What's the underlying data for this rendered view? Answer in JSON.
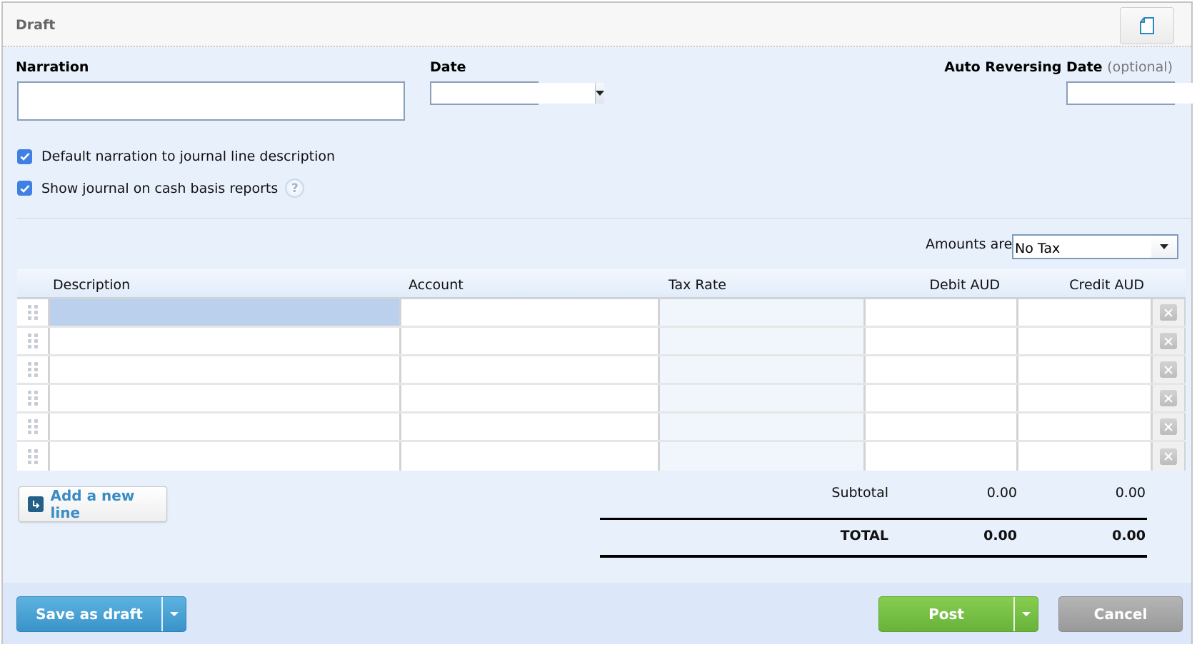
{
  "header": {
    "title": "Draft",
    "doc_button_icon": "document-icon"
  },
  "form": {
    "narration_label": "Narration",
    "narration_value": "",
    "date_label": "Date",
    "date_value": "",
    "auto_reversing_label": "Auto Reversing Date",
    "auto_reversing_optional": "(optional)",
    "auto_reversing_value": "",
    "checkboxes": [
      {
        "label": "Default narration to journal line description",
        "checked": true
      },
      {
        "label": "Show journal on cash basis reports",
        "checked": true,
        "help_icon": "question-mark"
      }
    ],
    "help_glyph": "?",
    "amounts_are_label": "Amounts are",
    "amounts_are_value": "No Tax"
  },
  "grid": {
    "columns": [
      "Description",
      "Account",
      "Tax Rate",
      "Debit AUD",
      "Credit AUD"
    ],
    "rows": [
      {
        "description": "",
        "account": "",
        "tax_rate": "",
        "debit": "",
        "credit": "",
        "active": true
      },
      {
        "description": "",
        "account": "",
        "tax_rate": "",
        "debit": "",
        "credit": ""
      },
      {
        "description": "",
        "account": "",
        "tax_rate": "",
        "debit": "",
        "credit": ""
      },
      {
        "description": "",
        "account": "",
        "tax_rate": "",
        "debit": "",
        "credit": ""
      },
      {
        "description": "",
        "account": "",
        "tax_rate": "",
        "debit": "",
        "credit": ""
      },
      {
        "description": "",
        "account": "",
        "tax_rate": "",
        "debit": "",
        "credit": ""
      }
    ]
  },
  "add_line_label": "Add a new line",
  "totals": {
    "subtotal_label": "Subtotal",
    "subtotal_debit": "0.00",
    "subtotal_credit": "0.00",
    "total_label": "TOTAL",
    "total_debit": "0.00",
    "total_credit": "0.00"
  },
  "footer": {
    "save_draft_label": "Save as draft",
    "post_label": "Post",
    "cancel_label": "Cancel"
  },
  "colors": {
    "save_blue": "#4aa3d6",
    "post_green": "#78c046",
    "cancel_gray": "#a6a6a6",
    "link_blue": "#3a8cc4",
    "checkbox_blue": "#3f80e4"
  }
}
